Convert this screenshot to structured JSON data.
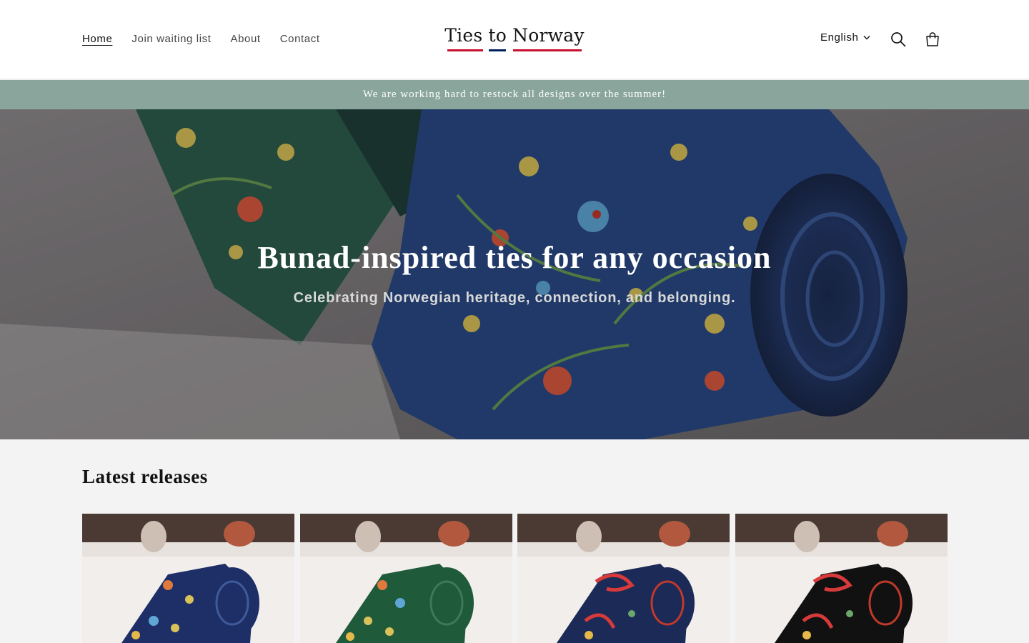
{
  "header": {
    "nav": [
      {
        "label": "Home",
        "active": true
      },
      {
        "label": "Join waiting list",
        "active": false
      },
      {
        "label": "About",
        "active": false
      },
      {
        "label": "Contact",
        "active": false
      }
    ],
    "logo_text": "Ties to Norway",
    "logo_colors": {
      "red": "#c8102e",
      "blue": "#00205b"
    },
    "language": "English",
    "icons": [
      "search-icon",
      "cart-icon",
      "chevron-down-icon"
    ]
  },
  "announcement": "We are working hard to restock all designs over the summer!",
  "hero": {
    "title": "Bunad-inspired ties for any occasion",
    "subtitle": "Celebrating Norwegian heritage, connection, and belonging."
  },
  "latest": {
    "title": "Latest releases",
    "products": [
      {
        "tie_color": "#1d2f66",
        "pattern": "floral-yellow-blue"
      },
      {
        "tie_color": "#1f5a3a",
        "pattern": "floral-blue-yellow"
      },
      {
        "tie_color": "#1b2a57",
        "pattern": "rose-red"
      },
      {
        "tie_color": "#111111",
        "pattern": "rose-red"
      }
    ]
  },
  "colors": {
    "announcement_bg": "#8aa69c",
    "page_bg": "#f3f3f3"
  }
}
